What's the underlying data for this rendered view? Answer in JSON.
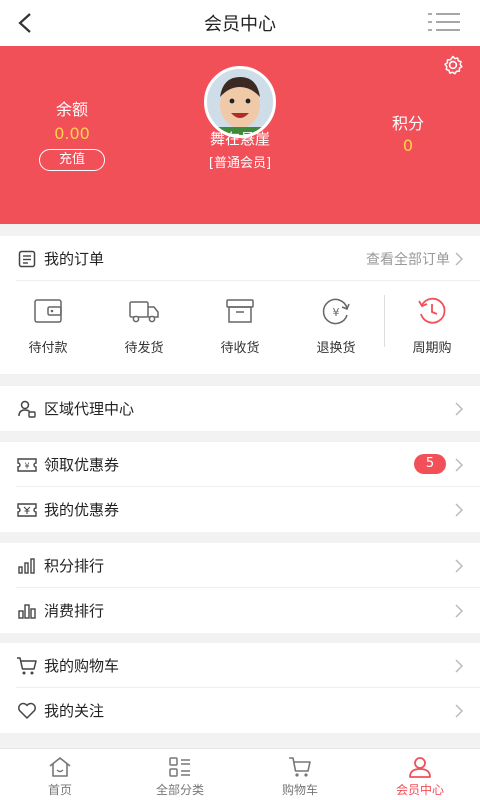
{
  "nav": {
    "title": "会员中心"
  },
  "profile": {
    "balance_label": "余额",
    "balance_value": "0.00",
    "recharge_label": "充值",
    "username": "舞在悬崖",
    "level": "[普通会员]",
    "points_label": "积分",
    "points_value": "0"
  },
  "orders": {
    "title": "我的订单",
    "view_all": "查看全部订单",
    "items": [
      {
        "label": "待付款",
        "icon": "wallet-icon"
      },
      {
        "label": "待发货",
        "icon": "truck-icon"
      },
      {
        "label": "待收货",
        "icon": "box-icon"
      },
      {
        "label": "退换货",
        "icon": "refund-icon"
      },
      {
        "label": "周期购",
        "icon": "clock-icon"
      }
    ]
  },
  "menu": {
    "agent": "区域代理中心",
    "get_coupons": "领取优惠券",
    "coupon_badge": "5",
    "my_coupons": "我的优惠券",
    "points_rank": "积分排行",
    "spend_rank": "消费排行",
    "cart": "我的购物车",
    "follow": "我的关注"
  },
  "tabs": [
    {
      "label": "首页",
      "icon": "home-icon"
    },
    {
      "label": "全部分类",
      "icon": "category-icon"
    },
    {
      "label": "购物车",
      "icon": "cart-icon"
    },
    {
      "label": "会员中心",
      "icon": "user-icon"
    }
  ],
  "colors": {
    "accent": "#f25058",
    "highlight": "#ffd24a"
  }
}
